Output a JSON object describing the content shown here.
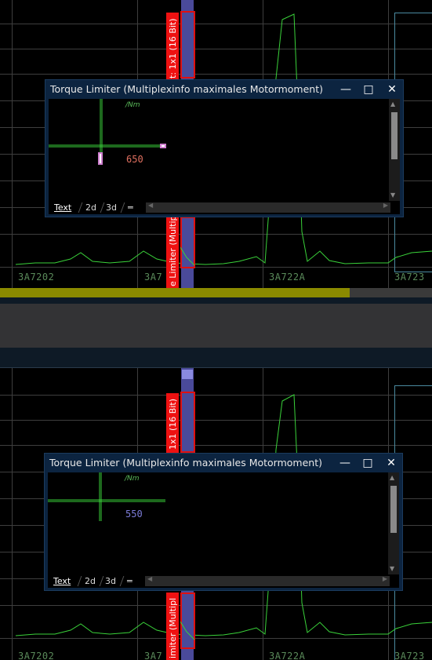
{
  "pane_top": {
    "hex_labels": [
      "3A7202",
      "3A7",
      "3A722A",
      "3A723"
    ],
    "vertical_tag": "t: 1x1 (16 Bit)",
    "vertical_tag_lower": "e Limiter  (Multiple",
    "window": {
      "title": "Torque Limiter  (Multiplexinfo maximales Motormoment)",
      "unit": "/Nm",
      "value": "650",
      "value_color": "#e07060",
      "tabs": [
        "Text",
        "2d",
        "3d",
        "═"
      ]
    }
  },
  "pane_bottom": {
    "hex_labels": [
      "3A7202",
      "3A7",
      "3A722A",
      "3A723"
    ],
    "vertical_tag": "1x1 (16 Bit)",
    "vertical_tag_lower": "imiter  (Multipl",
    "window": {
      "title": "Torque Limiter  (Multiplexinfo maximales Motormoment)",
      "unit": "/Nm",
      "value": "550",
      "value_color": "#7c7cd8",
      "tabs": [
        "Text",
        "2d",
        "3d",
        "═"
      ]
    }
  },
  "window_controls": {
    "minimize": "—",
    "maximize": "□",
    "close": "✕"
  },
  "progress": {
    "fill_fraction": 0.81
  },
  "colors": {
    "grid": "#3e3e3e",
    "trace": "#3ad23a",
    "selection": "#e01010",
    "window_frame": "#0c2440"
  }
}
